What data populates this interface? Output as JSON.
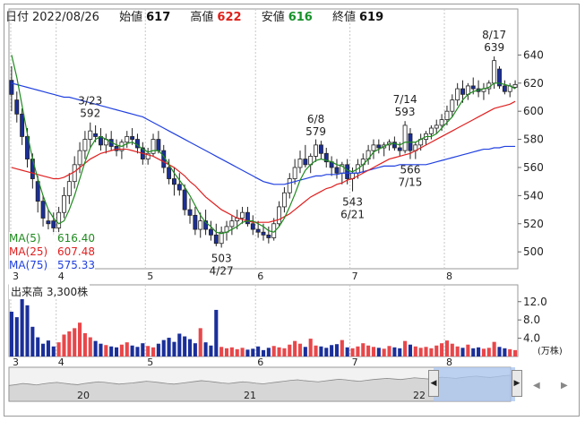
{
  "header": {
    "date_label": "日付",
    "date_value": "2022/08/26",
    "open_label": "始値",
    "open_value": "617",
    "high_label": "高値",
    "high_value": "622",
    "low_label": "安値",
    "low_value": "616",
    "close_label": "終値",
    "close_value": "619"
  },
  "legend": {
    "ma5_label": "MA(5)",
    "ma5_value": "616.40",
    "ma25_label": "MA(25)",
    "ma25_value": "607.48",
    "ma75_label": "MA(75)",
    "ma75_value": "575.33"
  },
  "volume_panel": {
    "label": "出来高 3,300株",
    "unit": "(万株)",
    "ticks": [
      "12.0",
      "8.0",
      "4.0"
    ]
  },
  "navigator": {
    "ticks": [
      "20",
      "21",
      "22"
    ]
  },
  "colors": {
    "up": "#ffffff",
    "down": "#1a2f9a",
    "ma5": "#1f8a1f",
    "ma25": "#e02020",
    "ma75": "#2040e0",
    "volume_up": "#e8474a",
    "volume_down": "#1a2f9a",
    "navigator_fill": "#a9c4ef"
  },
  "chart_data": {
    "type": "candlestick",
    "price_axis": {
      "ticks": [
        500,
        520,
        540,
        560,
        580,
        600,
        620,
        640
      ],
      "range": [
        488,
        660
      ]
    },
    "month_ticks": [
      "3",
      "4",
      "5",
      "6",
      "7",
      "8"
    ],
    "annotations": [
      {
        "date": "3/23",
        "value": 592
      },
      {
        "date": "4/27",
        "value": 503
      },
      {
        "date": "6/8",
        "value": 579
      },
      {
        "date": "6/21",
        "value": 543
      },
      {
        "date": "7/14",
        "value": 593
      },
      {
        "date": "7/15",
        "value": 566
      },
      {
        "date": "8/17",
        "value": 639
      }
    ],
    "candles": [
      [
        622,
        632,
        600,
        612
      ],
      [
        608,
        614,
        592,
        598
      ],
      [
        598,
        602,
        576,
        582
      ],
      [
        582,
        588,
        560,
        566
      ],
      [
        566,
        570,
        545,
        552
      ],
      [
        550,
        554,
        528,
        536
      ],
      [
        536,
        540,
        518,
        524
      ],
      [
        522,
        530,
        516,
        520
      ],
      [
        522,
        528,
        512,
        517
      ],
      [
        517,
        532,
        512,
        528
      ],
      [
        528,
        546,
        524,
        540
      ],
      [
        540,
        556,
        534,
        550
      ],
      [
        550,
        568,
        545,
        562
      ],
      [
        562,
        578,
        556,
        572
      ],
      [
        572,
        586,
        566,
        580
      ],
      [
        580,
        592,
        574,
        586
      ],
      [
        584,
        590,
        578,
        582
      ],
      [
        582,
        588,
        572,
        576
      ],
      [
        576,
        584,
        570,
        580
      ],
      [
        580,
        586,
        572,
        575
      ],
      [
        575,
        580,
        568,
        572
      ],
      [
        572,
        580,
        566,
        578
      ],
      [
        578,
        586,
        574,
        582
      ],
      [
        582,
        588,
        576,
        580
      ],
      [
        580,
        584,
        570,
        574
      ],
      [
        574,
        578,
        562,
        566
      ],
      [
        566,
        574,
        562,
        570
      ],
      [
        570,
        584,
        568,
        580
      ],
      [
        580,
        586,
        570,
        572
      ],
      [
        572,
        576,
        556,
        560
      ],
      [
        560,
        566,
        548,
        552
      ],
      [
        552,
        560,
        540,
        548
      ],
      [
        548,
        556,
        540,
        544
      ],
      [
        544,
        548,
        526,
        530
      ],
      [
        530,
        538,
        520,
        526
      ],
      [
        526,
        532,
        512,
        516
      ],
      [
        516,
        528,
        510,
        522
      ],
      [
        522,
        530,
        512,
        516
      ],
      [
        516,
        522,
        508,
        512
      ],
      [
        512,
        520,
        504,
        506
      ],
      [
        506,
        518,
        503,
        514
      ],
      [
        514,
        522,
        508,
        518
      ],
      [
        518,
        526,
        512,
        522
      ],
      [
        522,
        530,
        516,
        524
      ],
      [
        524,
        532,
        520,
        528
      ],
      [
        528,
        532,
        518,
        520
      ],
      [
        520,
        526,
        512,
        516
      ],
      [
        516,
        522,
        510,
        514
      ],
      [
        514,
        520,
        508,
        512
      ],
      [
        512,
        518,
        506,
        510
      ],
      [
        510,
        524,
        508,
        520
      ],
      [
        520,
        536,
        518,
        532
      ],
      [
        532,
        546,
        528,
        542
      ],
      [
        542,
        556,
        538,
        552
      ],
      [
        552,
        566,
        548,
        560
      ],
      [
        560,
        572,
        556,
        566
      ],
      [
        566,
        576,
        560,
        562
      ],
      [
        562,
        570,
        556,
        568
      ],
      [
        568,
        580,
        564,
        576
      ],
      [
        576,
        579,
        566,
        570
      ],
      [
        570,
        574,
        560,
        564
      ],
      [
        564,
        568,
        554,
        560
      ],
      [
        560,
        566,
        552,
        556
      ],
      [
        556,
        564,
        548,
        562
      ],
      [
        562,
        566,
        548,
        552
      ],
      [
        552,
        560,
        543,
        556
      ],
      [
        556,
        566,
        552,
        562
      ],
      [
        562,
        570,
        556,
        566
      ],
      [
        566,
        576,
        562,
        572
      ],
      [
        572,
        580,
        566,
        576
      ],
      [
        576,
        580,
        570,
        574
      ],
      [
        574,
        578,
        568,
        576
      ],
      [
        576,
        580,
        572,
        578
      ],
      [
        578,
        582,
        572,
        574
      ],
      [
        574,
        578,
        568,
        572
      ],
      [
        572,
        593,
        570,
        590
      ],
      [
        584,
        588,
        566,
        572
      ],
      [
        572,
        578,
        566,
        576
      ],
      [
        576,
        584,
        572,
        580
      ],
      [
        580,
        586,
        576,
        584
      ],
      [
        584,
        590,
        580,
        588
      ],
      [
        588,
        594,
        584,
        590
      ],
      [
        590,
        598,
        586,
        594
      ],
      [
        594,
        604,
        590,
        600
      ],
      [
        600,
        612,
        596,
        608
      ],
      [
        608,
        620,
        604,
        616
      ],
      [
        616,
        622,
        606,
        612
      ],
      [
        612,
        620,
        608,
        618
      ],
      [
        618,
        624,
        612,
        616
      ],
      [
        616,
        622,
        610,
        614
      ],
      [
        614,
        620,
        608,
        616
      ],
      [
        616,
        622,
        612,
        620
      ],
      [
        620,
        639,
        616,
        636
      ],
      [
        630,
        632,
        616,
        618
      ],
      [
        618,
        622,
        612,
        614
      ],
      [
        614,
        620,
        610,
        618
      ],
      [
        617,
        622,
        616,
        619
      ]
    ],
    "ma5": [
      640,
      624,
      604,
      584,
      566,
      552,
      540,
      530,
      524,
      520,
      522,
      530,
      540,
      552,
      564,
      574,
      580,
      582,
      580,
      578,
      576,
      575,
      577,
      578,
      576,
      573,
      571,
      572,
      572,
      568,
      562,
      556,
      551,
      546,
      540,
      533,
      526,
      521,
      518,
      514,
      513,
      514,
      516,
      518,
      521,
      522,
      522,
      520,
      518,
      515,
      514,
      518,
      524,
      532,
      541,
      551,
      558,
      562,
      565,
      566,
      565,
      564,
      562,
      561,
      558,
      557,
      559,
      562,
      566,
      571,
      573,
      575,
      577,
      577,
      576,
      578,
      578,
      578,
      580,
      582,
      582,
      584,
      588,
      592,
      596,
      602,
      608,
      612,
      614,
      615,
      616,
      617,
      620,
      620,
      619,
      618,
      616
    ],
    "ma25": [
      560,
      559,
      558,
      557,
      556,
      555,
      554,
      553,
      552,
      552,
      553,
      555,
      557,
      560,
      563,
      566,
      568,
      570,
      571,
      572,
      573,
      573,
      573,
      572,
      571,
      570,
      569,
      568,
      566,
      564,
      562,
      560,
      557,
      554,
      550,
      547,
      543,
      539,
      536,
      533,
      530,
      528,
      526,
      524,
      523,
      522,
      521,
      521,
      521,
      521,
      522,
      523,
      525,
      527,
      530,
      533,
      536,
      539,
      541,
      543,
      545,
      546,
      548,
      549,
      551,
      552,
      554,
      556,
      558,
      560,
      562,
      564,
      566,
      567,
      568,
      569,
      570,
      572,
      574,
      576,
      578,
      580,
      582,
      584,
      586,
      588,
      590,
      592,
      594,
      596,
      598,
      600,
      602,
      603,
      604,
      605,
      607
    ],
    "ma75": [
      620,
      619,
      618,
      617,
      616,
      615,
      614,
      613,
      612,
      611,
      610,
      610,
      609,
      608,
      607,
      606,
      605,
      604,
      603,
      602,
      601,
      600,
      599,
      598,
      597,
      596,
      594,
      592,
      590,
      588,
      586,
      584,
      582,
      580,
      578,
      576,
      574,
      572,
      570,
      568,
      566,
      564,
      562,
      560,
      558,
      556,
      554,
      552,
      550,
      549,
      548,
      548,
      548,
      549,
      550,
      551,
      552,
      553,
      554,
      554,
      555,
      555,
      555,
      556,
      556,
      556,
      556,
      557,
      558,
      559,
      560,
      561,
      561,
      561,
      562,
      562,
      562,
      562,
      562,
      562,
      563,
      564,
      565,
      566,
      567,
      568,
      569,
      570,
      571,
      572,
      573,
      573,
      574,
      574,
      575,
      575,
      575
    ],
    "volume": [
      9.8,
      8.6,
      14.5,
      11.2,
      6.5,
      4.2,
      2.8,
      3.5,
      2.2,
      3.1,
      4.8,
      5.5,
      6.2,
      7.4,
      5.1,
      4.2,
      3.4,
      2.8,
      2.5,
      2.2,
      2.0,
      2.6,
      3.1,
      2.4,
      2.1,
      2.9,
      2.3,
      2.0,
      2.8,
      3.6,
      4.1,
      3.2,
      5.0,
      4.4,
      3.8,
      2.9,
      6.2,
      3.1,
      2.4,
      10.2,
      2.1,
      1.8,
      2.0,
      1.6,
      1.9,
      1.5,
      1.7,
      2.2,
      1.4,
      1.9,
      2.3,
      2.0,
      1.8,
      2.6,
      3.4,
      2.8,
      2.1,
      3.9,
      2.4,
      2.2,
      1.9,
      2.5,
      2.7,
      3.6,
      2.0,
      1.8,
      2.2,
      2.9,
      2.4,
      2.1,
      1.9,
      1.7,
      2.3,
      2.0,
      1.8,
      3.4,
      2.6,
      2.2,
      1.9,
      2.1,
      1.8,
      2.4,
      2.9,
      3.5,
      2.8,
      2.2,
      1.9,
      2.6,
      1.8,
      2.0,
      1.7,
      1.9,
      3.2,
      2.1,
      1.8,
      1.6,
      1.4
    ],
    "navigator_series": [
      0.55,
      0.58,
      0.62,
      0.6,
      0.57,
      0.61,
      0.64,
      0.66,
      0.63,
      0.6,
      0.58,
      0.62,
      0.65,
      0.68,
      0.66,
      0.63,
      0.6,
      0.62,
      0.64,
      0.67,
      0.7,
      0.68,
      0.65,
      0.62,
      0.6,
      0.63,
      0.66,
      0.69,
      0.72,
      0.7,
      0.67,
      0.64,
      0.62,
      0.65,
      0.68,
      0.66,
      0.63,
      0.61,
      0.64,
      0.67,
      0.7,
      0.73,
      0.75,
      0.72,
      0.7,
      0.68,
      0.71,
      0.74,
      0.77,
      0.75,
      0.72,
      0.7,
      0.73,
      0.76,
      0.78,
      0.8,
      0.78,
      0.76,
      0.79,
      0.82,
      0.8,
      0.78,
      0.81,
      0.84,
      0.82,
      0.8,
      0.83,
      0.86,
      0.88,
      0.85,
      0.83,
      0.86,
      0.89,
      0.91
    ]
  }
}
